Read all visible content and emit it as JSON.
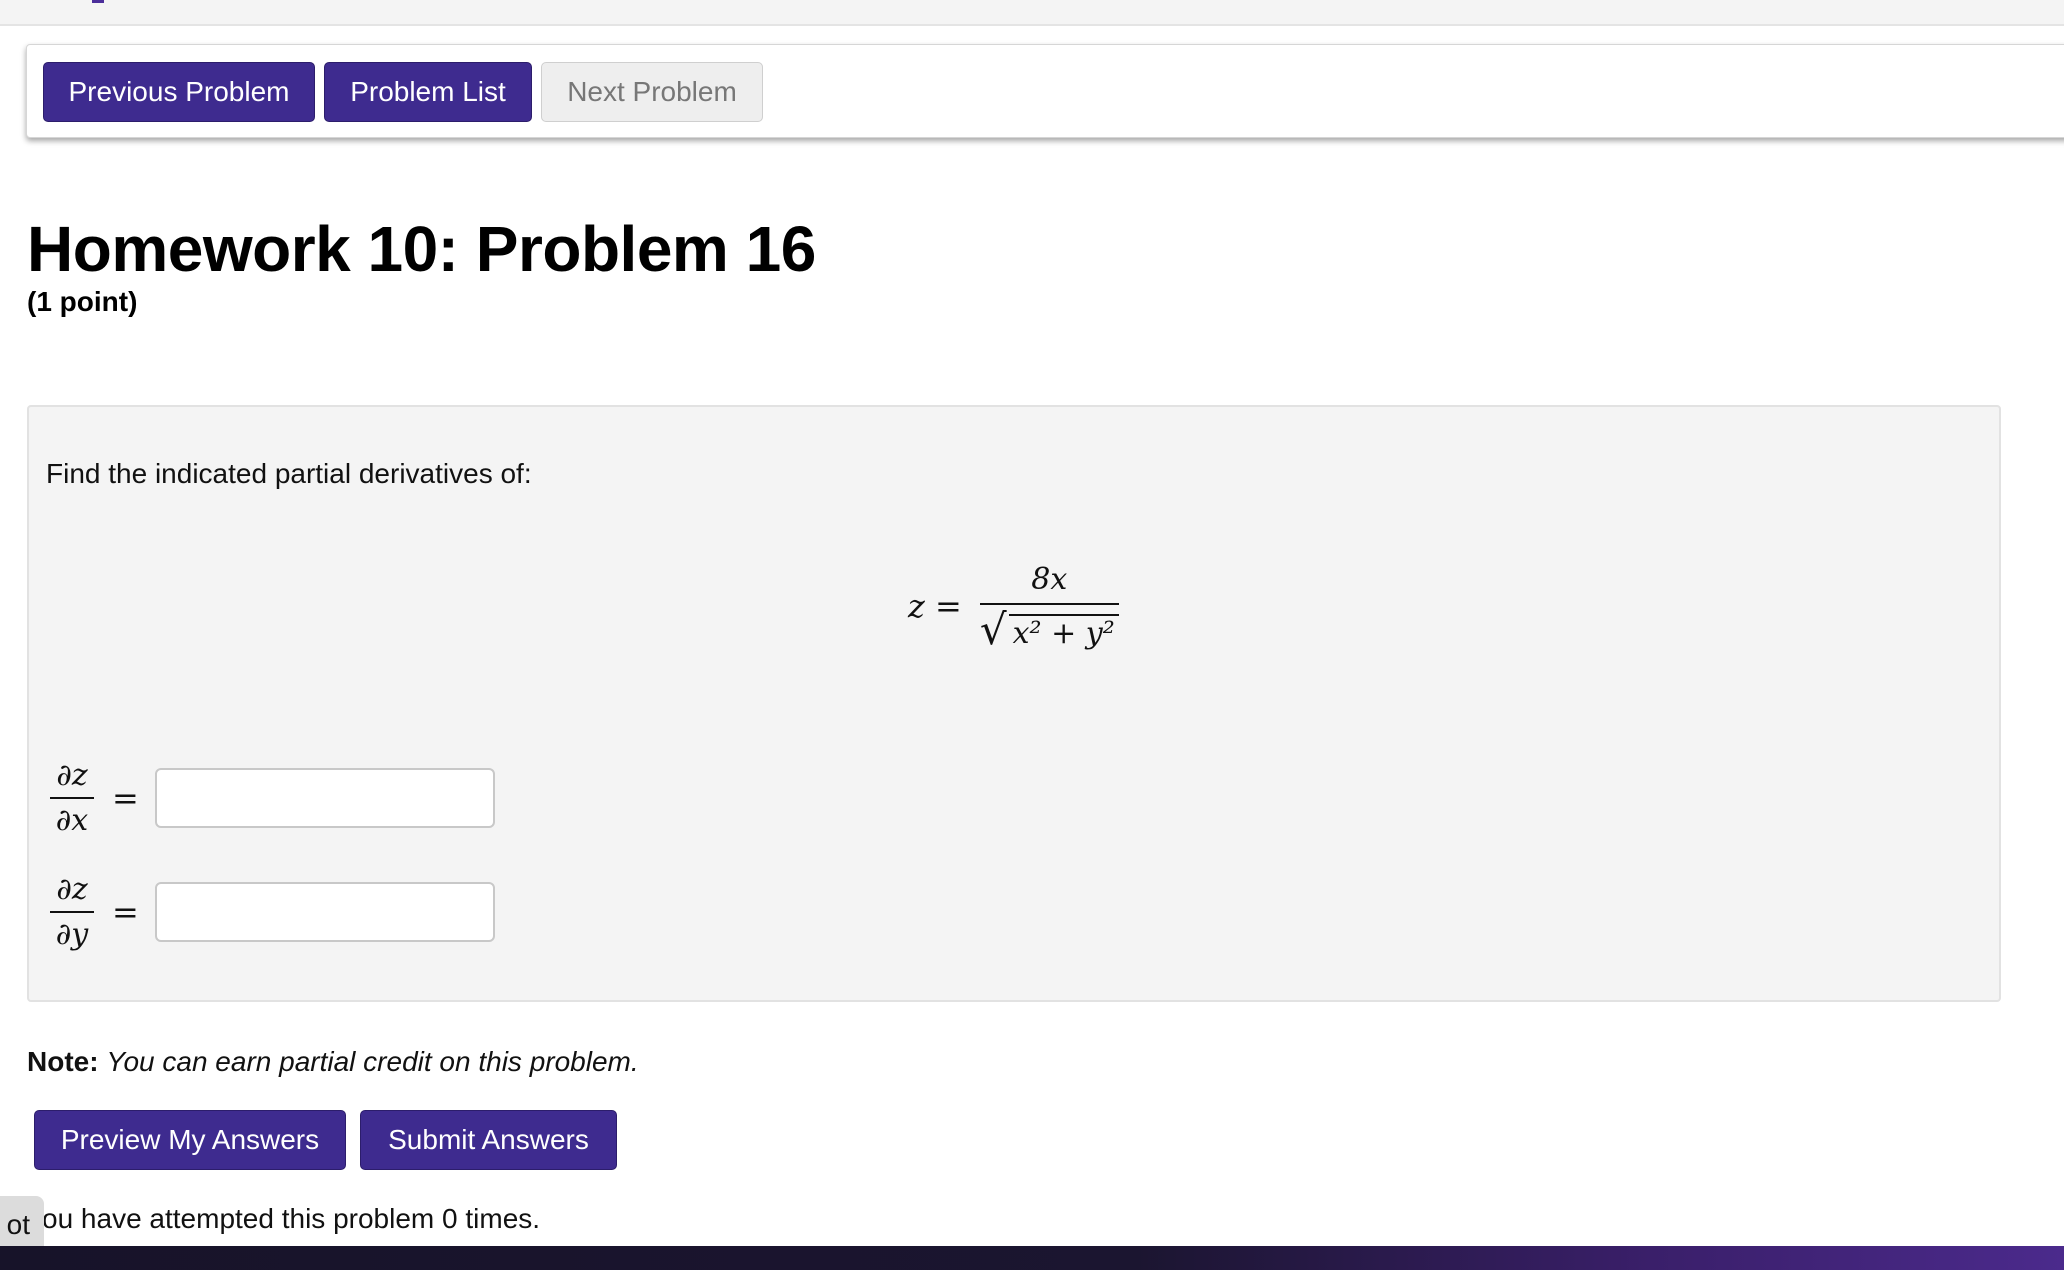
{
  "nav": {
    "previous_label": "Previous Problem",
    "list_label": "Problem List",
    "next_label": "Next Problem"
  },
  "problem": {
    "title": "Homework 10: Problem 16",
    "points": "(1 point)",
    "prompt": "Find the indicated partial derivatives of:",
    "equation": {
      "lhs": "z =",
      "numerator": "8x",
      "sqrt_symbol": "√",
      "radicand": "x² + y²"
    },
    "answers": [
      {
        "numerator": "∂z",
        "denominator": "∂x",
        "equals": "=",
        "value": ""
      },
      {
        "numerator": "∂z",
        "denominator": "∂y",
        "equals": "=",
        "value": ""
      }
    ]
  },
  "note": {
    "label": "Note:",
    "text": "You can earn partial credit on this problem."
  },
  "actions": {
    "preview_label": "Preview My Answers",
    "submit_label": "Submit Answers"
  },
  "attempts_text": "ou have attempted this problem 0 times.",
  "side_tab_label": "ot",
  "colors": {
    "primary_button": "#3e2b8f",
    "disabled_button": "#eeeeee",
    "problem_box_bg": "#f4f4f4"
  }
}
